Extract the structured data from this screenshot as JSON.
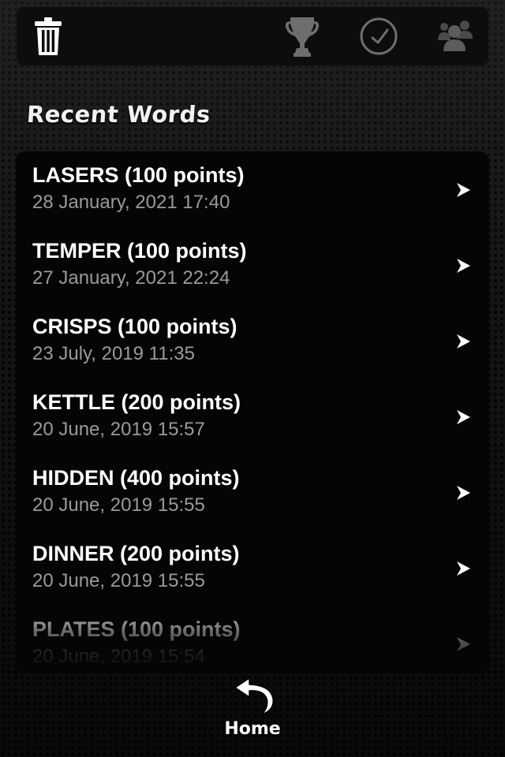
{
  "toolbar": {
    "icons": [
      "trash-icon",
      "trophy-icon",
      "clock-icon",
      "people-icon"
    ]
  },
  "section_title": "Recent Words",
  "words": [
    {
      "word": "LASERS (100 points)",
      "date": "28 January, 2021 17:40"
    },
    {
      "word": "TEMPER (100 points)",
      "date": "27 January, 2021 22:24"
    },
    {
      "word": "CRISPS (100 points)",
      "date": "23 July, 2019 11:35"
    },
    {
      "word": "KETTLE (200 points)",
      "date": "20 June, 2019 15:57"
    },
    {
      "word": "HIDDEN (400 points)",
      "date": "20 June, 2019 15:55"
    },
    {
      "word": "DINNER (200 points)",
      "date": "20 June, 2019 15:55"
    },
    {
      "word": "PLATES (100 points)",
      "date": "20 June, 2019 15:54"
    }
  ],
  "home": {
    "label": "Home",
    "icon": "back-arrow-icon"
  },
  "colors": {
    "text": "#ffffff",
    "date": "#9a9a9a",
    "icon_dim": "#6a6a6a"
  }
}
